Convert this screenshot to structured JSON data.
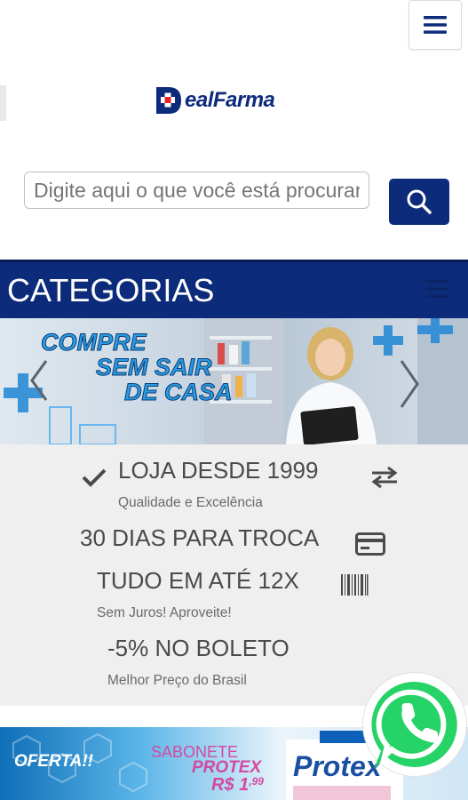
{
  "logo": {
    "text": "DealFarma",
    "letter_d": "D",
    "word": "ealFarma"
  },
  "search": {
    "placeholder": "Digite aqui o que você está procurando"
  },
  "categories": {
    "title": "CATEGORIAS"
  },
  "banner": {
    "line1": "COMPRE",
    "line2": "SEM SAIR",
    "line3": "DE CASA"
  },
  "features": {
    "loja": "LOJA DESDE 1999",
    "qualidade": "Qualidade e Excelência",
    "troca": "30 DIAS PARA TROCA",
    "parcelas": "TUDO EM ATÉ 12X",
    "juros": "Sem Juros! Aproveite!",
    "boleto": "-5% NO BOLETO",
    "preco": "Melhor Preço do Brasil"
  },
  "offer": {
    "tag": "OFERTA!!",
    "line1": "SABONETE",
    "line2": "PROTEX",
    "price_main": "R$ 1",
    "price_cents": ",99",
    "brand": "Protex"
  },
  "colors": {
    "brand_blue": "#0c2b7a",
    "whatsapp_green": "#25d366"
  },
  "icons": [
    "menu-icon",
    "search-icon",
    "check-icon",
    "exchange-icon",
    "credit-card-icon",
    "barcode-icon",
    "whatsapp-icon"
  ]
}
